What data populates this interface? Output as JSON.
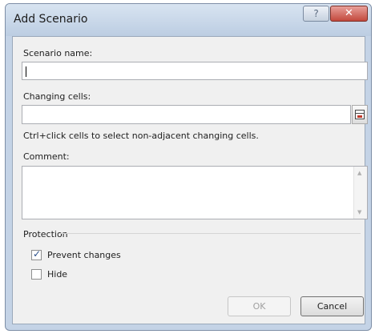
{
  "window": {
    "title": "Add Scenario",
    "help_glyph": "?",
    "close_glyph": "✕"
  },
  "fields": {
    "scenario_name": {
      "label": "Scenario name:",
      "value": ""
    },
    "changing_cells": {
      "label": "Changing cells:",
      "value": "",
      "ref_icon": "range-select-icon"
    },
    "hint": "Ctrl+click cells to select non-adjacent changing cells.",
    "comment": {
      "label": "Comment:",
      "value": ""
    }
  },
  "protection": {
    "group_label": "Protection",
    "prevent_changes": {
      "label": "Prevent changes",
      "checked": true
    },
    "hide": {
      "label": "Hide",
      "checked": false
    }
  },
  "buttons": {
    "ok": {
      "label": "OK",
      "enabled": false
    },
    "cancel": {
      "label": "Cancel",
      "enabled": true
    }
  },
  "colors": {
    "title_bar": "#c4d3e6",
    "close_button": "#c3493d",
    "checkbox_tick": "#2a4f8a"
  }
}
